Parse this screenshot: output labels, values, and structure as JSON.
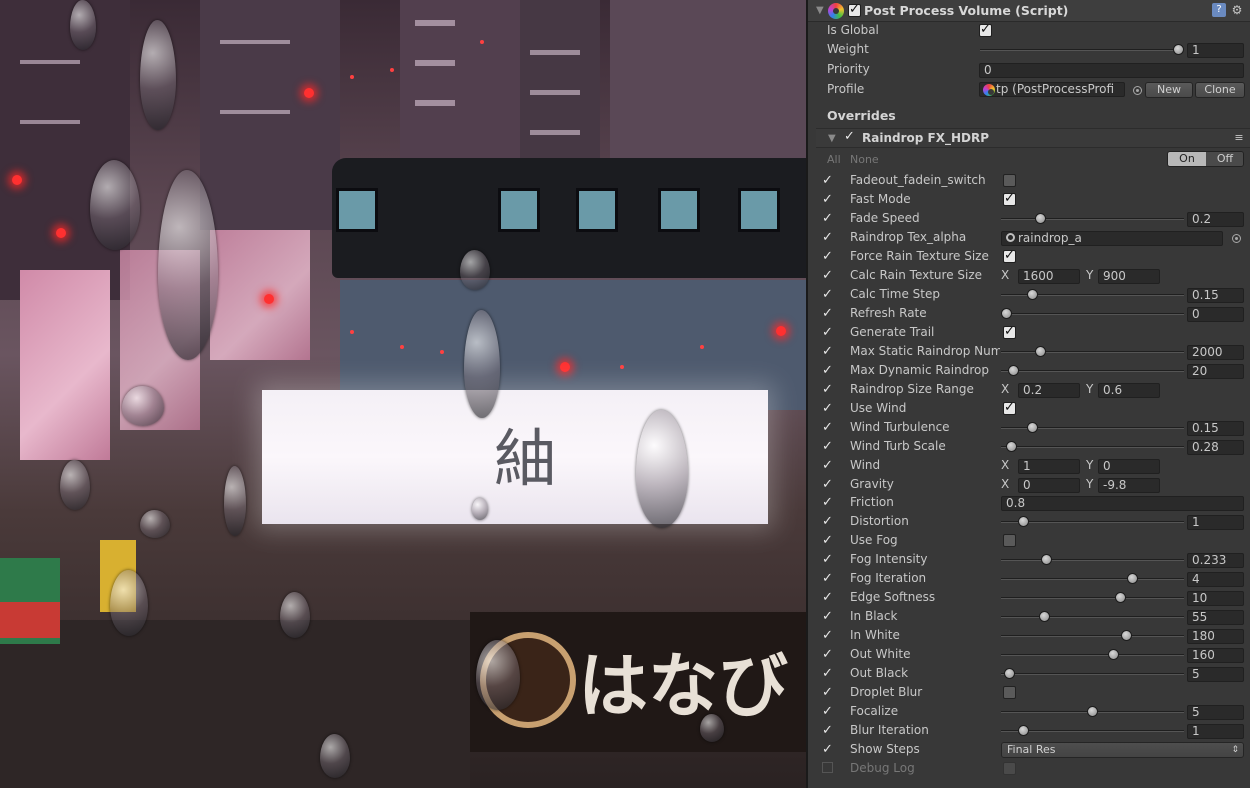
{
  "component": {
    "title": "Post Process Volume (Script)",
    "enabled": true
  },
  "volume": {
    "is_global": {
      "label": "Is Global",
      "checked": true
    },
    "weight": {
      "label": "Weight",
      "value": "1",
      "fraction": 1.0
    },
    "priority": {
      "label": "Priority",
      "value": "0"
    },
    "profile": {
      "label": "Profile",
      "value": "tp (PostProcessProfi",
      "new_label": "New",
      "clone_label": "Clone"
    }
  },
  "overrides": {
    "section_label": "Overrides",
    "effect_title": "Raindrop FX_HDRP",
    "all_label": "All",
    "none_label": "None",
    "on_label": "On",
    "off_label": "Off"
  },
  "params": [
    {
      "name": "Fadeout_fadein_switch",
      "kind": "checkbox",
      "checked": false
    },
    {
      "name": "Fast Mode",
      "kind": "checkbox",
      "checked": true
    },
    {
      "name": "Fade Speed",
      "kind": "slider",
      "value": "0.2",
      "fraction": 0.2
    },
    {
      "name": "Raindrop Tex_alpha",
      "kind": "object",
      "value": "raindrop_a"
    },
    {
      "name": "Force Rain Texture Size",
      "kind": "checkbox",
      "checked": true
    },
    {
      "name": "Calc Rain Texture Size",
      "kind": "vector2",
      "x": "1600",
      "y": "900"
    },
    {
      "name": "Calc Time Step",
      "kind": "slider",
      "value": "0.15",
      "fraction": 0.15
    },
    {
      "name": "Refresh Rate",
      "kind": "slider",
      "value": "0",
      "fraction": 0.0
    },
    {
      "name": "Generate Trail",
      "kind": "checkbox",
      "checked": true
    },
    {
      "name": "Max Static Raindrop Num",
      "kind": "slider",
      "value": "2000",
      "fraction": 0.2
    },
    {
      "name": "Max Dynamic Raindrop",
      "kind": "slider",
      "value": "20",
      "fraction": 0.04
    },
    {
      "name": "Raindrop Size Range",
      "kind": "vector2",
      "x": "0.2",
      "y": "0.6"
    },
    {
      "name": "Use Wind",
      "kind": "checkbox",
      "checked": true
    },
    {
      "name": "Wind Turbulence",
      "kind": "slider",
      "value": "0.15",
      "fraction": 0.15
    },
    {
      "name": "Wind Turb Scale",
      "kind": "slider",
      "value": "0.28",
      "fraction": 0.03
    },
    {
      "name": "Wind",
      "kind": "vector2",
      "x": "1",
      "y": "0"
    },
    {
      "name": "Gravity",
      "kind": "vector2",
      "x": "0",
      "y": "-9.8"
    },
    {
      "name": "Friction",
      "kind": "float",
      "value": "0.8"
    },
    {
      "name": "Distortion",
      "kind": "slider",
      "value": "1",
      "fraction": 0.1
    },
    {
      "name": "Use Fog",
      "kind": "checkbox",
      "checked": false
    },
    {
      "name": "Fog Intensity",
      "kind": "slider",
      "value": "0.233",
      "fraction": 0.233
    },
    {
      "name": "Fog Iteration",
      "kind": "slider",
      "value": "4",
      "fraction": 0.73
    },
    {
      "name": "Edge Softness",
      "kind": "slider",
      "value": "10",
      "fraction": 0.66
    },
    {
      "name": "In Black",
      "kind": "slider",
      "value": "55",
      "fraction": 0.22
    },
    {
      "name": "In White",
      "kind": "slider",
      "value": "180",
      "fraction": 0.7
    },
    {
      "name": "Out White",
      "kind": "slider",
      "value": "160",
      "fraction": 0.62
    },
    {
      "name": "Out Black",
      "kind": "slider",
      "value": "5",
      "fraction": 0.02
    },
    {
      "name": "Droplet Blur",
      "kind": "checkbox",
      "checked": false
    },
    {
      "name": "Focalize",
      "kind": "slider",
      "value": "5",
      "fraction": 0.5
    },
    {
      "name": "Blur Iteration",
      "kind": "slider",
      "value": "1",
      "fraction": 0.1
    },
    {
      "name": "Show Steps",
      "kind": "dropdown",
      "value": "Final Res"
    },
    {
      "name": "Debug Log",
      "kind": "checkbox",
      "checked": false,
      "disabled": true
    }
  ],
  "scene": {
    "billboard_text": "紬",
    "lower_sign_text": "はなび"
  },
  "colors": {
    "inspector_bg": "#383838",
    "field_bg": "#2a2a2a",
    "toggle_on": "#b8b8b8",
    "help_icon": "#6a8ac0"
  }
}
